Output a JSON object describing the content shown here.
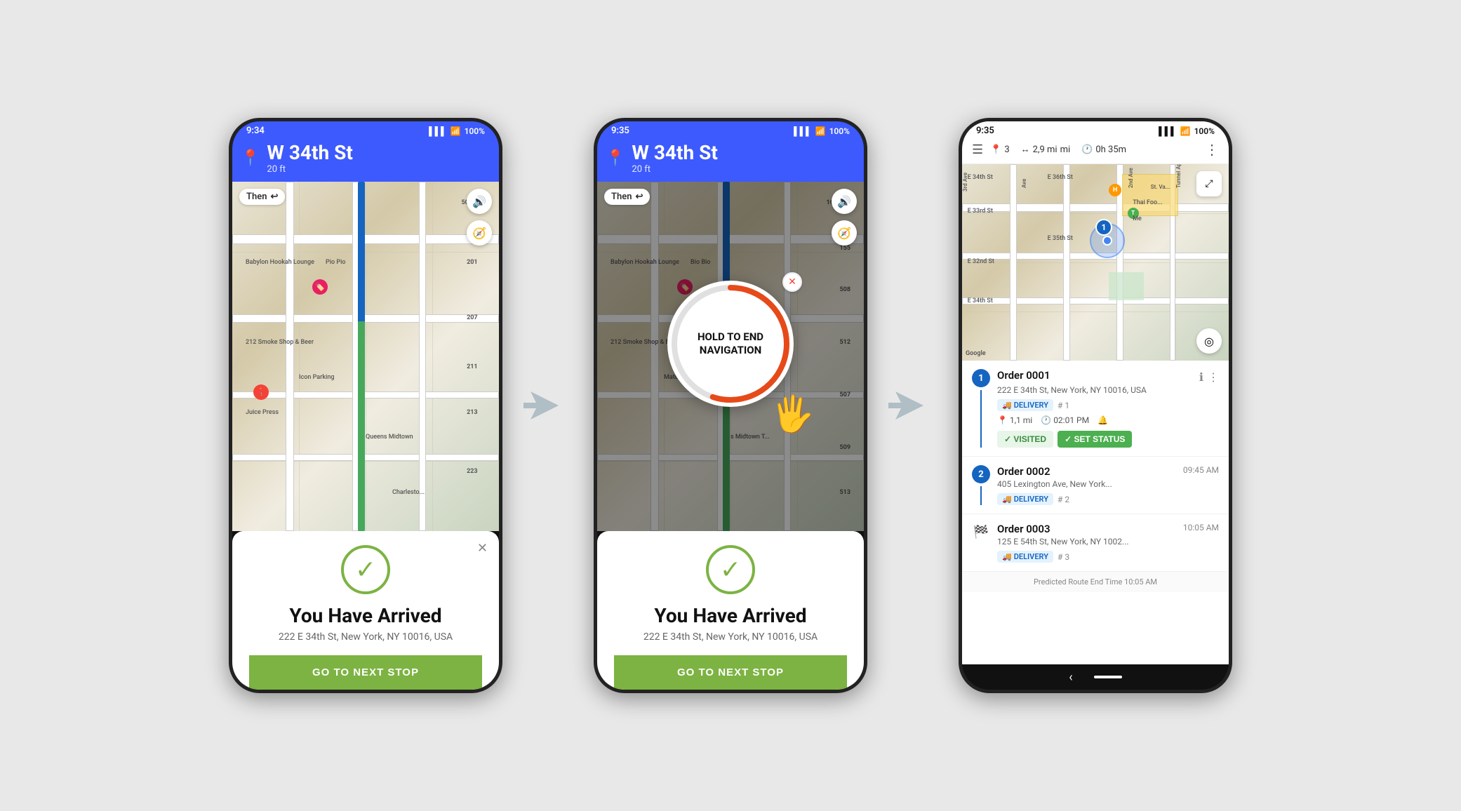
{
  "scene": {
    "bg_color": "#e8e8e8"
  },
  "phone1": {
    "status_bar": {
      "time": "9:34",
      "battery": "100%"
    },
    "nav_header": {
      "street": "W 34th St",
      "distance": "20 ft"
    },
    "then_label": "Then",
    "map_controls": {
      "sound_icon": "🔊",
      "compass_icon": "🧭"
    },
    "bottom_card": {
      "check_icon": "✓",
      "title": "You Have Arrived",
      "address": "222 E 34th St, New York, NY 10016, USA",
      "button_label": "GO TO NEXT STOP"
    }
  },
  "phone2": {
    "status_bar": {
      "time": "9:35",
      "battery": "100%"
    },
    "nav_header": {
      "street": "W 34th St",
      "distance": "20 ft"
    },
    "then_label": "Then",
    "hold_text": "HOLD TO END\nNAVIGATION",
    "bottom_card": {
      "title": "You Have Arrived",
      "address": "222 E 34th St, New York, NY 10016, USA",
      "button_label": "GO TO NEXT STOP"
    }
  },
  "phone3": {
    "status_bar": {
      "time": "9:35",
      "battery": "100%"
    },
    "route_header": {
      "stops": "3",
      "distance": "2,9 mi",
      "time": "0h 35m"
    },
    "orders": [
      {
        "num": "1",
        "title": "Order 0001",
        "time": "",
        "address": "222 E 34th St, New York, NY 10016, USA",
        "tag": "DELIVERY",
        "hash": "# 1",
        "distance": "1,1 mi",
        "eta": "02:01 PM",
        "visited": true,
        "set_status": true
      },
      {
        "num": "2",
        "title": "Order 0002",
        "time": "09:45 AM",
        "address": "405 Lexington Ave, New York...",
        "tag": "DELIVERY",
        "hash": "# 2",
        "distance": "",
        "eta": "",
        "visited": false,
        "set_status": false
      },
      {
        "num": "flag",
        "title": "Order 0003",
        "time": "10:05 AM",
        "address": "125 E 54th St, New York, NY 1002...",
        "tag": "DELIVERY",
        "hash": "# 3",
        "distance": "",
        "eta": "",
        "visited": false,
        "set_status": false
      }
    ],
    "footer": "Predicted Route End Time 10:05 AM"
  },
  "arrows": {
    "symbol": "➤"
  }
}
